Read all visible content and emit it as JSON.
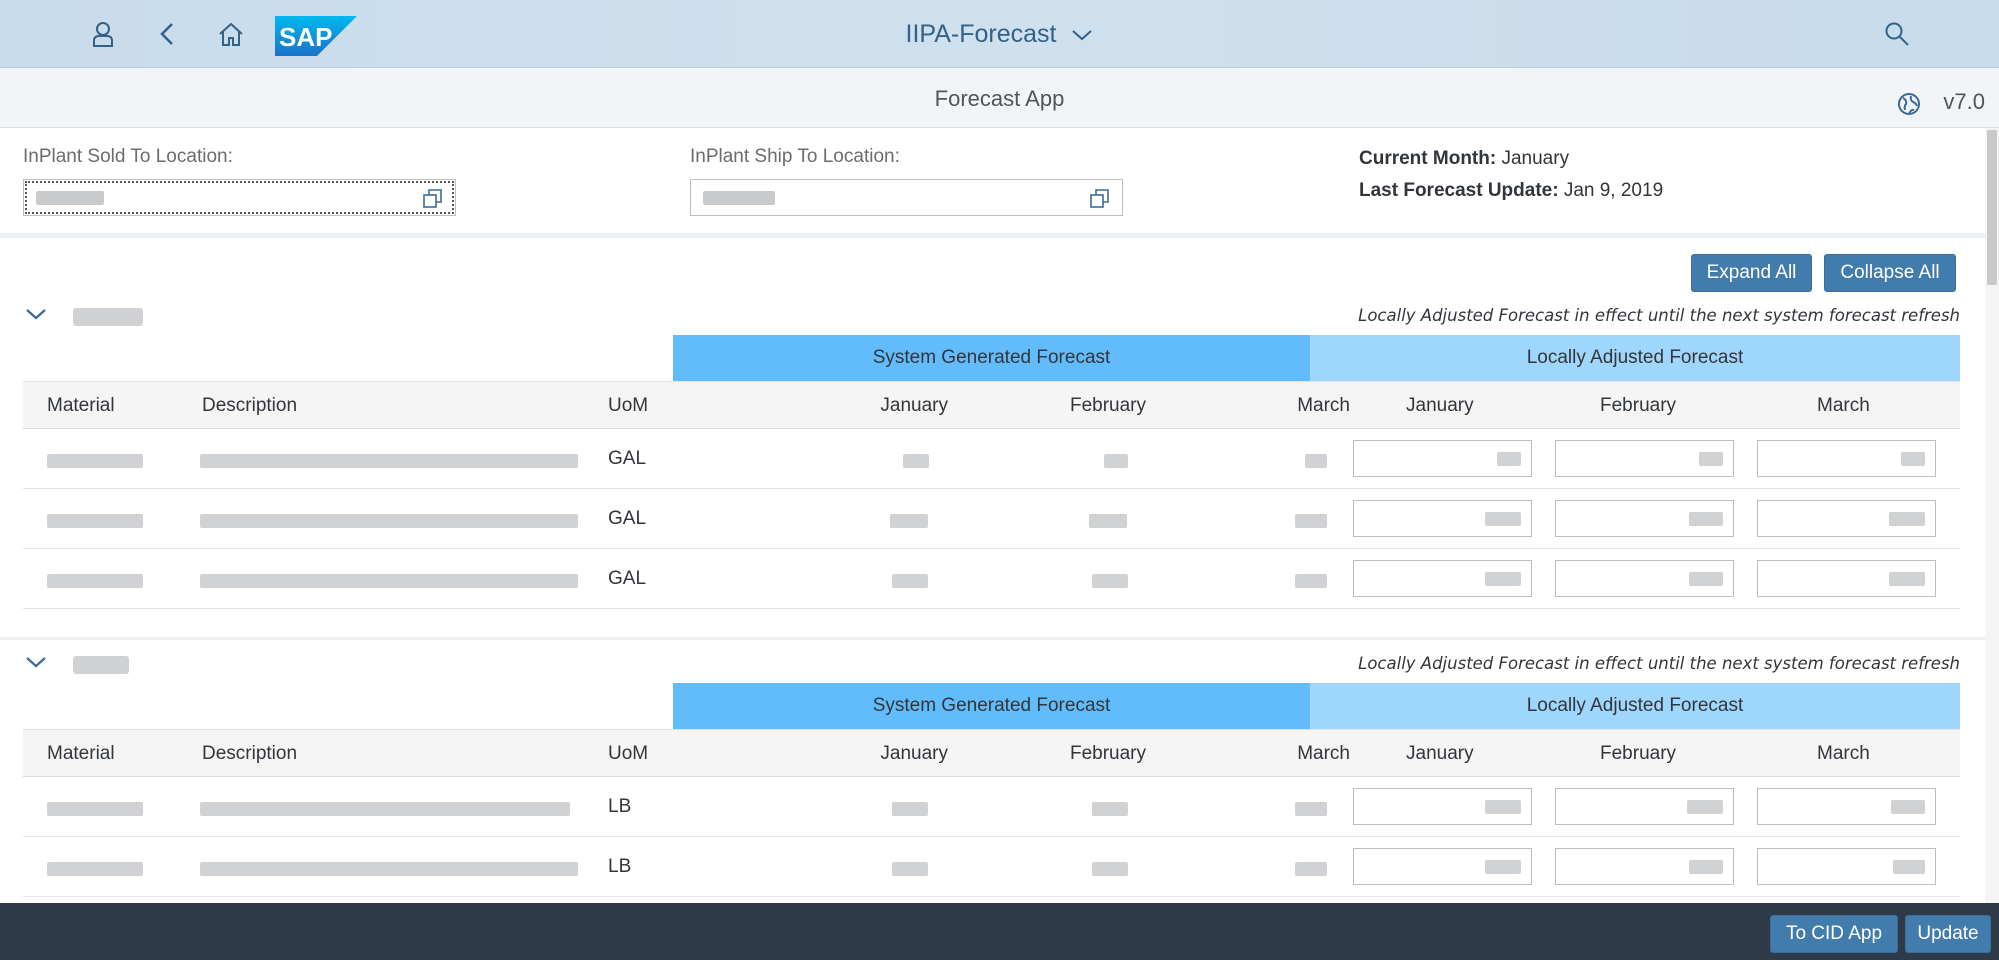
{
  "shell": {
    "title": "IIPA-Forecast",
    "logo_text": "SAP",
    "icons": [
      "user-icon",
      "back-icon",
      "home-icon",
      "search-icon",
      "chevron-down-icon"
    ]
  },
  "subheader": {
    "app_title": "Forecast App",
    "version": "v7.0"
  },
  "filters": {
    "sold_to_label": "InPlant Sold To Location:",
    "ship_to_label": "InPlant Ship To Location:",
    "current_month_label": "Current Month:",
    "current_month_value": "January",
    "last_update_label": "Last Forecast Update:",
    "last_update_value": "Jan 9, 2019"
  },
  "actions": {
    "expand_all": "Expand All",
    "collapse_all": "Collapse All"
  },
  "note": "Locally Adjusted Forecast in effect until the next system forecast refresh",
  "bands": {
    "system": "System Generated Forecast",
    "local": "Locally Adjusted Forecast"
  },
  "columns": {
    "material": "Material",
    "description": "Description",
    "uom": "UoM",
    "sys_months": [
      "January",
      "February",
      "March"
    ],
    "loc_months": [
      "January",
      "February",
      "March"
    ]
  },
  "sections": [
    {
      "rows": [
        {
          "uom": "GAL"
        },
        {
          "uom": "GAL"
        },
        {
          "uom": "GAL"
        }
      ]
    },
    {
      "rows": [
        {
          "uom": "LB"
        },
        {
          "uom": "LB"
        }
      ]
    }
  ],
  "footer": {
    "to_cid": "To CID App",
    "update": "Update"
  },
  "colors": {
    "shell_bg": "#cfe0ee",
    "system_band": "#62bcfb",
    "local_band": "#9fd6fd",
    "button": "#427cac",
    "footer": "#2e3a48"
  }
}
